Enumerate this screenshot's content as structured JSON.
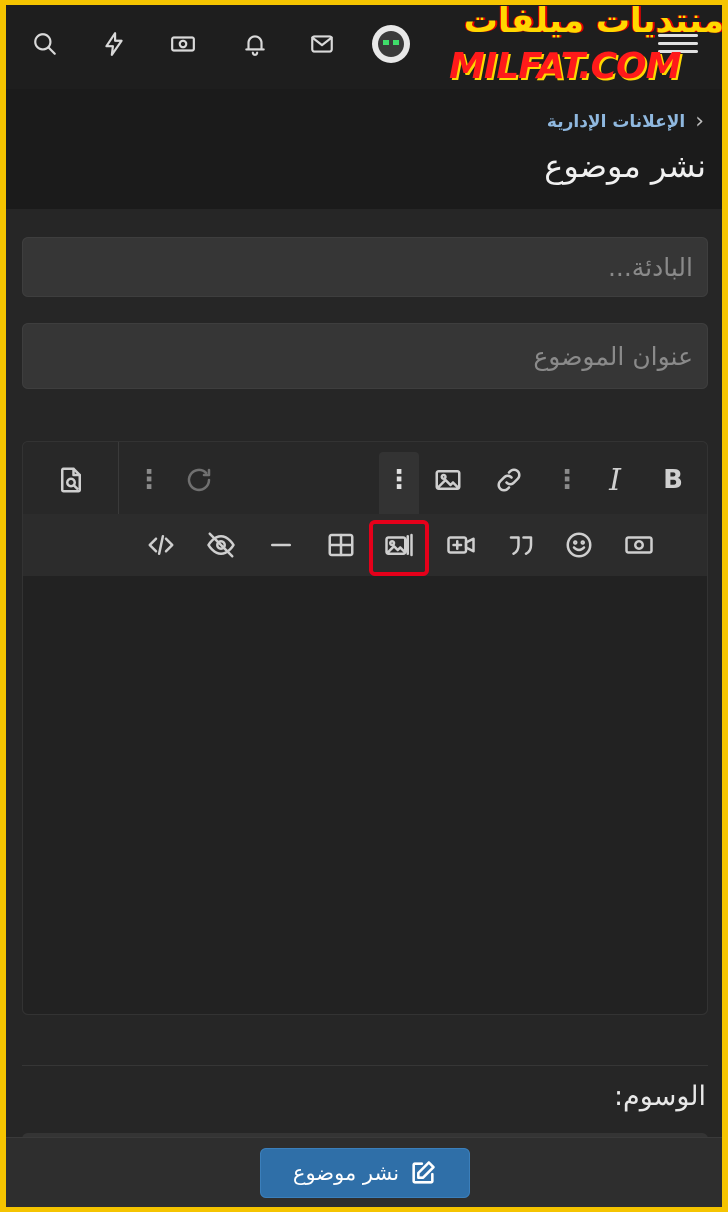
{
  "watermark": {
    "arabic": "منتديات ميلفات",
    "latin": "MILFAT.COM"
  },
  "nav": {
    "icons": [
      "search-icon",
      "bolt-icon",
      "money-icon",
      "bell-icon",
      "mail-icon",
      "avatar",
      "menu-icon"
    ]
  },
  "breadcrumb": {
    "label": "الإعلانات الإدارية",
    "chevron": "‹"
  },
  "page": {
    "title": "نشر موضوع"
  },
  "form": {
    "prefix_placeholder": "البادئة...",
    "title_placeholder": "عنوان الموضوع"
  },
  "editor": {
    "bold_label": "B",
    "italic_label": "I",
    "highlighted_tool": "insert-gallery"
  },
  "tags": {
    "label": "الوسوم:"
  },
  "footer": {
    "submit_label": "نشر موضوع"
  },
  "colors": {
    "accent": "#2f6fa8",
    "highlight_box": "#e5001a",
    "border_frame": "#f5c400"
  }
}
